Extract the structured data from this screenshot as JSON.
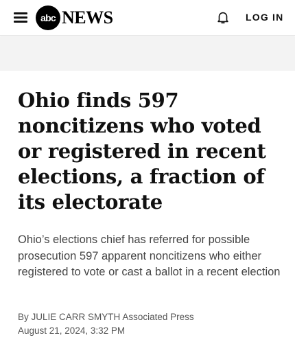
{
  "header": {
    "logo_mark": "abc",
    "logo_word": "NEWS",
    "login_label": "LOG IN",
    "icons": [
      "menu-icon",
      "bell-icon"
    ]
  },
  "article": {
    "headline": "Ohio finds 597 noncitizens who voted or registered in recent elections, a fraction of its electorate",
    "dek": "Ohio’s elections chief has referred for possible prosecution 597 apparent noncitizens who either registered to vote or cast a ballot in a recent election",
    "byline_prefix": "By",
    "author": "JULIE CARR SMYTH",
    "outlet": "Associated Press",
    "date": "August 21, 2024, 3:32 PM"
  },
  "colors": {
    "ad_band": "#f3f3f3",
    "text_primary": "#111111",
    "text_secondary": "#444444"
  }
}
